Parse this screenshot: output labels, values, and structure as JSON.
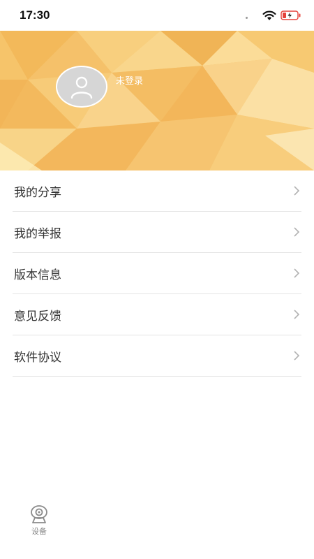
{
  "status_bar": {
    "time": "17:30",
    "icons": [
      "wifi-icon",
      "battery-charging-icon"
    ]
  },
  "profile": {
    "avatar_icon": "user-icon",
    "login_status": "未登录"
  },
  "menu": {
    "items": [
      {
        "label": "我的分享"
      },
      {
        "label": "我的举报"
      },
      {
        "label": "版本信息"
      },
      {
        "label": "意见反馈"
      },
      {
        "label": "软件协议"
      }
    ]
  },
  "tab_bar": {
    "tabs": [
      {
        "label": "设备",
        "icon": "camera-icon"
      }
    ]
  },
  "colors": {
    "banner_gold": "#f6c46a",
    "divider": "#e4e4e4",
    "text": "#333333",
    "battery_charge": "#e5423b"
  }
}
